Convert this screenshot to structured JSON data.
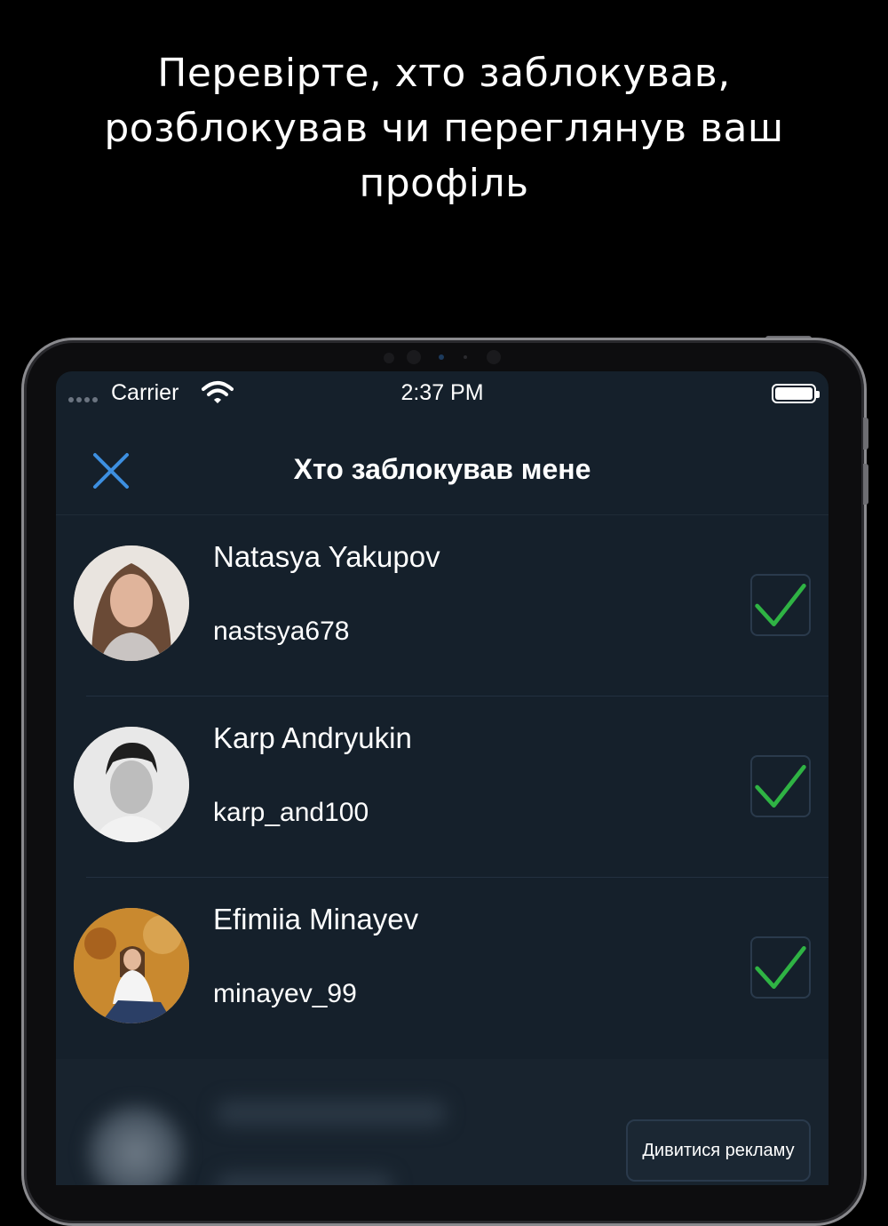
{
  "headline": {
    "line1": "Перевірте, хто заблокував,",
    "line2": "розблокував чи переглянув ваш",
    "line3": "профіль"
  },
  "status_bar": {
    "carrier": "Carrier",
    "time": "2:37 PM"
  },
  "nav": {
    "title": "Хто заблокував мене",
    "close_icon": "close-icon"
  },
  "users": [
    {
      "name": "Natasya Yakupov",
      "username": "nastsya678",
      "checked": true
    },
    {
      "name": "Karp Andryukin",
      "username": "karp_and100",
      "checked": true
    },
    {
      "name": "Efimiia Minayev",
      "username": "minayev_99",
      "checked": true
    }
  ],
  "ad_button": {
    "label": "Дивитися рекламу"
  },
  "colors": {
    "background": "#000000",
    "screen": "#15202b",
    "accent": "#3d8fe0",
    "check": "#2fb344"
  }
}
